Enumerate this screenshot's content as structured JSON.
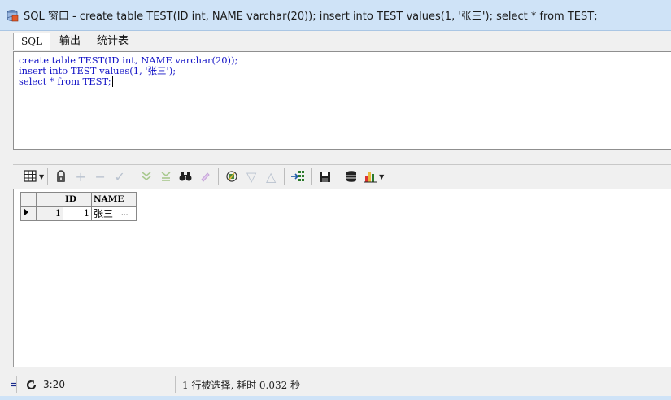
{
  "window": {
    "title": "SQL 窗口 - create table TEST(ID int, NAME varchar(20)); insert into TEST values(1, '张三'); select * from TEST;"
  },
  "tabs": [
    {
      "label": "SQL",
      "active": true
    },
    {
      "label": "输出",
      "active": false
    },
    {
      "label": "统计表",
      "active": false
    }
  ],
  "editor": {
    "lines": [
      "create table TEST(ID int, NAME varchar(20));",
      "insert into TEST values(1, '张三');",
      "select * from TEST;"
    ]
  },
  "toolbar": {
    "buttons": [
      {
        "icon": "grid-icon",
        "dropdown": true
      },
      {
        "icon": "lock-icon"
      },
      {
        "icon": "plus-icon",
        "disabled": true
      },
      {
        "icon": "minus-icon",
        "disabled": true
      },
      {
        "icon": "check-icon",
        "disabled": true
      },
      {
        "icon": "filter-down-icon",
        "disabled": true
      },
      {
        "icon": "filter-clear-icon",
        "disabled": true
      },
      {
        "icon": "binoculars-icon"
      },
      {
        "icon": "pencil-icon",
        "disabled": true
      },
      {
        "icon": "query-by-example-icon"
      },
      {
        "icon": "arrow-down-icon",
        "disabled": true
      },
      {
        "icon": "arrow-up-icon",
        "disabled": true
      },
      {
        "icon": "export-icon"
      },
      {
        "icon": "save-icon"
      },
      {
        "icon": "database-icon"
      },
      {
        "icon": "chart-icon",
        "dropdown": true
      }
    ]
  },
  "grid": {
    "columns": [
      "ID",
      "NAME"
    ],
    "rows": [
      {
        "row_number": "1",
        "ID": "1",
        "NAME": "张三",
        "ellipsis": "···"
      }
    ]
  },
  "status": {
    "position": "3:20",
    "message": "1 行被选择, 耗时 0.032 秒"
  },
  "colors": {
    "sql_text": "#1313c6",
    "titlebar": "#cfe3f7"
  }
}
